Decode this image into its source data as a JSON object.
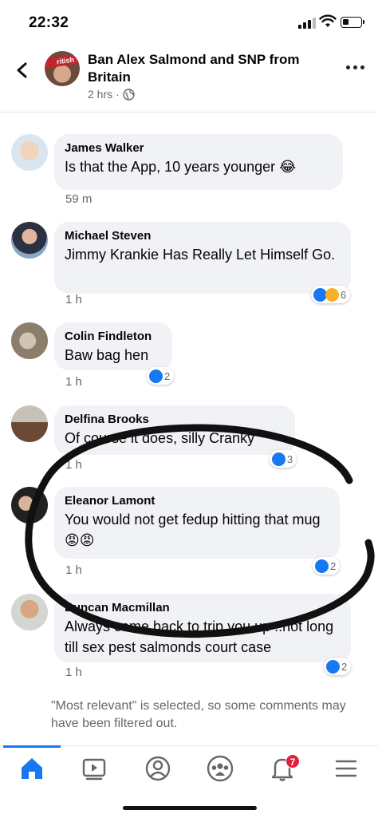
{
  "status_bar": {
    "time": "22:32"
  },
  "post_header": {
    "group_name": "Ban Alex Salmond and SNP from Britain",
    "avatar_text": "ritish",
    "time_ago": "2 hrs",
    "separator": "·",
    "privacy_icon": "globe-icon"
  },
  "comments": [
    {
      "name": "James Walker",
      "text": "Is that the App, 10 years younger 😂",
      "time": "59 m",
      "reactions": null
    },
    {
      "name": "Michael Steven",
      "text": "Jimmy Krankie Has Really Let Himself Go.",
      "time": "1 h",
      "reactions": {
        "icons": [
          "like-icon",
          "haha-icon"
        ],
        "count": "6"
      }
    },
    {
      "name": "Colin Findleton",
      "text": "Baw bag hen",
      "time": "1 h",
      "reactions": {
        "icons": [
          "like-icon"
        ],
        "count": "2"
      }
    },
    {
      "name": "Delfina Brooks",
      "text": "Of course it does, silly Cranky",
      "time": "1 h",
      "reactions": {
        "icons": [
          "like-icon"
        ],
        "count": "3"
      }
    },
    {
      "name": "Eleanor Lamont",
      "text": "You would not get fedup hitting that mug😡😡",
      "time": "1 h",
      "reactions": {
        "icons": [
          "like-icon"
        ],
        "count": "2"
      }
    },
    {
      "name": "Duncan Macmillan",
      "text": "Always come back to trip you up ..not long till sex pest salmonds court case",
      "time": "1 h",
      "reactions": {
        "icons": [
          "like-icon"
        ],
        "count": "2"
      }
    }
  ],
  "filter_note": "\"Most relevant\" is selected, so some comments may have been filtered out.",
  "tabbar": {
    "tabs": [
      "home-icon",
      "watch-icon",
      "profile-icon",
      "groups-icon",
      "notifications-icon",
      "menu-icon"
    ],
    "notifications_badge": "7"
  },
  "colors": {
    "accent": "#1877f2",
    "bubble": "#f0f2f5",
    "badge": "#e41e3f",
    "muted": "#65676b",
    "haha": "#f7b125"
  }
}
